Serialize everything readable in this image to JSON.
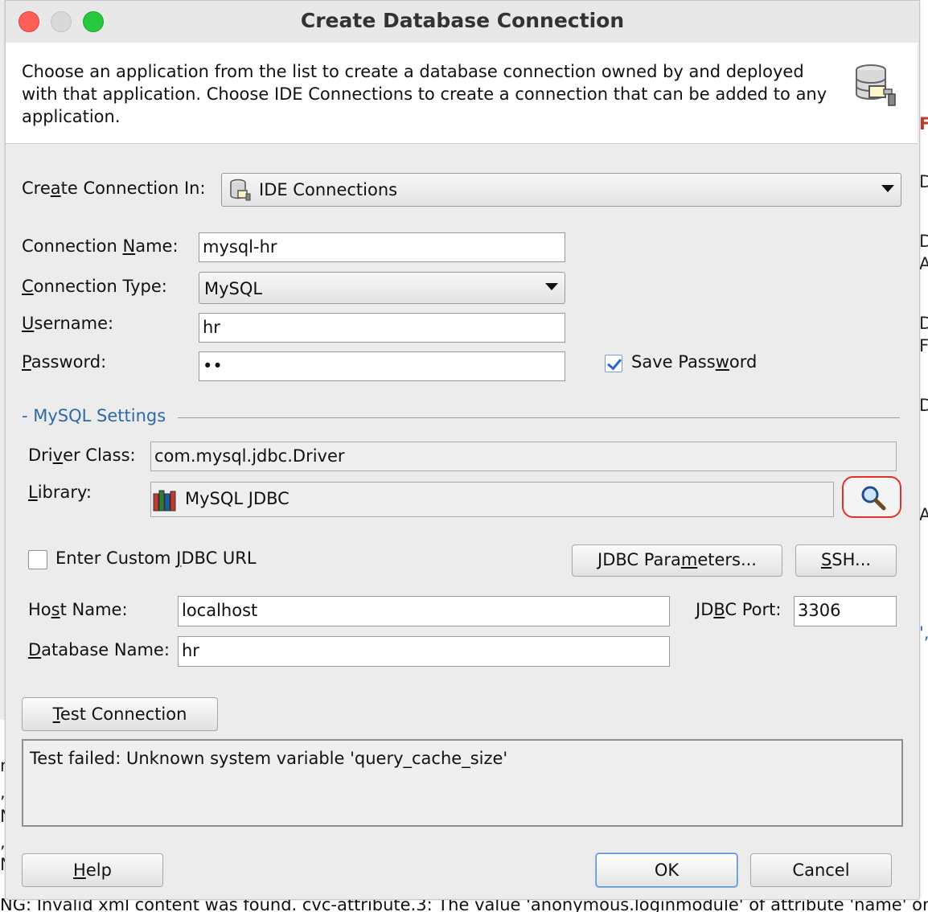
{
  "window": {
    "title": "Create Database Connection"
  },
  "header": {
    "description": "Choose an application from the list to create a database connection owned by and deployed with that application. Choose IDE Connections to create a connection that can be added to any application."
  },
  "create_in": {
    "label_pre": "Cre",
    "label_key": "a",
    "label_post": "te Connection In:",
    "value": "IDE Connections"
  },
  "connection_name": {
    "label_pre": "Connection ",
    "label_key": "N",
    "label_post": "ame:",
    "value": "mysql-hr"
  },
  "connection_type": {
    "label_pre": "",
    "label_key": "C",
    "label_post": "onnection Type:",
    "value": "MySQL"
  },
  "username": {
    "label_pre": "",
    "label_key": "U",
    "label_post": "sername:",
    "value": "hr"
  },
  "password": {
    "label_pre": "",
    "label_key": "P",
    "label_post": "assword:",
    "value": "••"
  },
  "save_password": {
    "label_pre": "Save Pass",
    "label_key": "w",
    "label_post": "ord",
    "checked": true
  },
  "mysql_settings": {
    "title": "- MySQL Settings"
  },
  "driver_class": {
    "label_pre": "Dri",
    "label_key": "v",
    "label_post": "er Class:",
    "value": "com.mysql.jdbc.Driver"
  },
  "library": {
    "label_pre": "",
    "label_key": "L",
    "label_post": "ibrary:",
    "value": "MySQL JDBC"
  },
  "custom_url": {
    "label_pre": "Enter Custom ",
    "label_key": "J",
    "label_post": "DBC URL",
    "checked": false
  },
  "jdbc_parameters_button": {
    "pre": "JDBC Para",
    "key": "m",
    "post": "eters..."
  },
  "ssh_button": {
    "pre": "",
    "key": "S",
    "post": "SH..."
  },
  "host_name": {
    "label_pre": "Ho",
    "label_key": "s",
    "label_post": "t Name:",
    "value": "localhost"
  },
  "jdbc_port": {
    "label_pre": "JD",
    "label_key": "B",
    "label_post": "C Port:",
    "value": "3306"
  },
  "database_name": {
    "label_pre": "",
    "label_key": "D",
    "label_post": "atabase Name:",
    "value": "hr"
  },
  "test_button": {
    "pre": "",
    "key": "T",
    "post": "est Connection"
  },
  "test_result": "Test failed: Unknown system variable 'query_cache_size'",
  "help_button": {
    "pre": "",
    "key": "H",
    "post": "elp"
  },
  "ok_button": "OK",
  "cancel_button": "Cancel",
  "background": {
    "right_fragments": [
      "Fo",
      "D",
      "D",
      "A",
      "D",
      "F",
      "D",
      "A",
      "',"
    ],
    "left_fragments": [
      "ng",
      ",",
      "N",
      ",",
      "N"
    ],
    "bottom_text": "NG: Invalid xml content was found. cvc-attribute.3: The value 'anonymous.loginmodule' of attribute 'name' on"
  },
  "colors": {
    "accent": "#2f6aa8",
    "highlight_ring": "#e0312a",
    "close": "#ff5f57",
    "maximize": "#28c840"
  },
  "icons": [
    "database-connection-icon",
    "ide-connections-icon",
    "library-books-icon",
    "search-icon"
  ]
}
